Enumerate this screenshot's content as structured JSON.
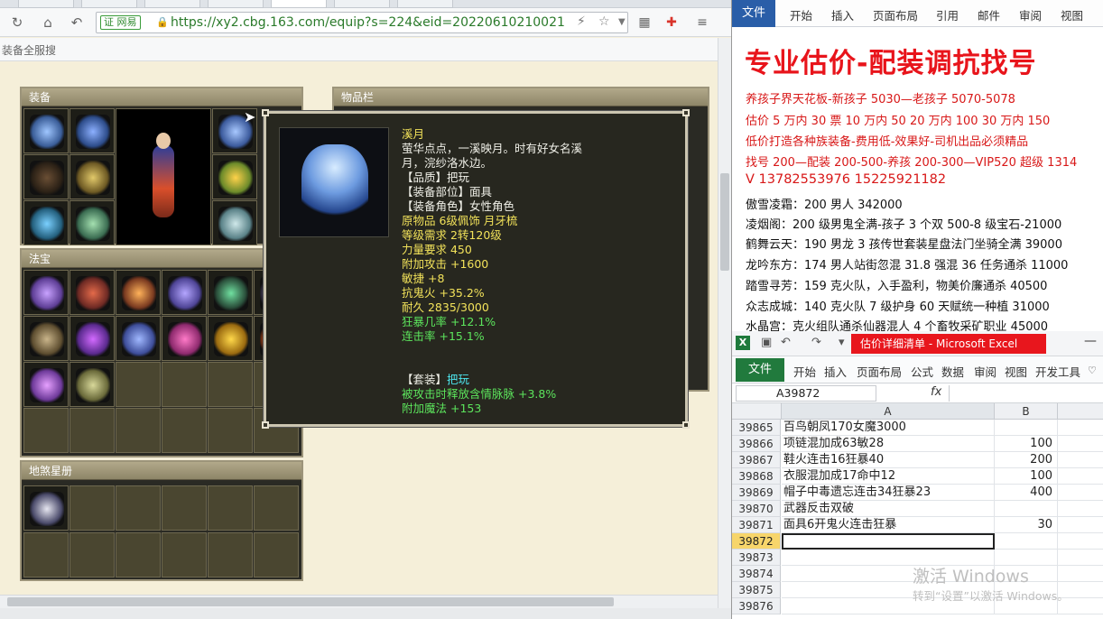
{
  "browser": {
    "url": "https://xy2.cbg.163.com/equip?s=224&eid=20220610210021",
    "cert_label": "证 网易",
    "bookmark": "装备全服搜"
  },
  "game": {
    "equip_header": "装备",
    "inventory_header": "物品栏",
    "fabao_header": "法宝",
    "dishaxing_header": "地煞星册"
  },
  "tooltip": {
    "title": "溪月",
    "lines": [
      {
        "text": "萤华点点，一溪映月。时有好女名溪",
        "color": "w"
      },
      {
        "text": "月，浣纱洛水边。",
        "color": "w"
      },
      {
        "text": "【品质】把玩",
        "color": "w"
      },
      {
        "text": "【装备部位】面具",
        "color": "w"
      },
      {
        "text": "【装备角色】女性角色",
        "color": "w"
      },
      {
        "text": "原物品 6级佩饰 月牙梳",
        "color": "y"
      },
      {
        "text": "等级需求 2转120级",
        "color": "y"
      },
      {
        "text": "力量要求 450",
        "color": "y"
      },
      {
        "text": "附加攻击 +1600",
        "color": "y"
      },
      {
        "text": "敏捷 +8",
        "color": "y"
      },
      {
        "text": "抗鬼火 +35.2%",
        "color": "y"
      },
      {
        "text": "耐久 2835/3000",
        "color": "y"
      },
      {
        "text": "狂暴几率 +12.1%",
        "color": "g"
      },
      {
        "text": "连击率 +15.1%",
        "color": "g"
      }
    ],
    "set_label": "【套装】",
    "set_name": "把玩",
    "set_lines": [
      "被攻击时释放含情脉脉 +3.8%",
      "附加魔法 +153"
    ]
  },
  "word": {
    "tabs": [
      "文件",
      "开始",
      "插入",
      "页面布局",
      "引用",
      "邮件",
      "审阅",
      "视图"
    ],
    "title": "专业估价-配装调抗找号",
    "red_lines": [
      "养孩子界天花板-新孩子 5030—老孩子 5070-5078",
      "估价 5 万内 30 票   10 万内 50  20 万内 100  30 万内 150",
      "低价打造各种族装备-费用低-效果好-司机出品必须精品",
      "找号 200—配装 200-500-养孩 200-300—VIP520 超级 1314",
      "V     13782553976      15225921182"
    ],
    "black_lines": [
      "傲雪凌霜：200 男人 342000",
      "凌烟阁：200 级男鬼全满-孩子 3 个双 500-8 级宝石-21000",
      "鹤舞云天：190 男龙 3 孩传世套装星盘法门坐骑全满 39000",
      "龙吟东方：174 男人站街忽混 31.8 强混 36 任务通杀 11000",
      "踏雪寻芳：159 克火队，入手盈利，物美价廉通杀 40500",
      "众志成城：140 克火队 7 级护身 60 天赋统一种植 31000",
      "水晶宫：克火组队通杀仙器混人 4 个畜牧采矿职业 45000"
    ]
  },
  "excel": {
    "title": "估价详细清单 - Microsoft Excel",
    "file_tab": "文件",
    "tabs": [
      "开始",
      "插入",
      "页面布局",
      "公式",
      "数据",
      "审阅",
      "视图",
      "开发工具"
    ],
    "name_box": "A39872",
    "fx": "fx",
    "col_a": "A",
    "col_b": "B",
    "rows": [
      {
        "num": "39865",
        "a": "百鸟朝凤170女魔3000",
        "b": ""
      },
      {
        "num": "39866",
        "a": "项链混加成63敏28",
        "b": "100"
      },
      {
        "num": "39867",
        "a": "鞋火连击16狂暴40",
        "b": "200"
      },
      {
        "num": "39868",
        "a": "衣服混加成17命中12",
        "b": "100"
      },
      {
        "num": "39869",
        "a": "帽子中毒遗忘连击34狂暴23",
        "b": "400"
      },
      {
        "num": "39870",
        "a": "武器反击双破",
        "b": ""
      },
      {
        "num": "39871",
        "a": "面具6开鬼火连击狂暴",
        "b": "30"
      },
      {
        "num": "39872",
        "a": "",
        "b": ""
      },
      {
        "num": "39873",
        "a": "",
        "b": ""
      },
      {
        "num": "39874",
        "a": "",
        "b": ""
      },
      {
        "num": "39875",
        "a": "",
        "b": ""
      },
      {
        "num": "39876",
        "a": "",
        "b": ""
      }
    ],
    "watermark_title": "激活 Windows",
    "watermark_sub": "转到“设置”以激活 Windows。"
  }
}
